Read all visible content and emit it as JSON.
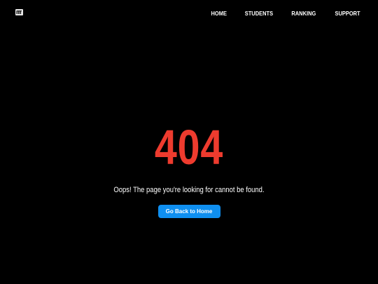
{
  "header": {
    "logo_icon": "logo-icon",
    "nav": {
      "home": "HOME",
      "students": "STUDENTS",
      "ranking": "RANKING",
      "support": "SUPPORT"
    }
  },
  "error": {
    "code": "404",
    "message": "Oops! The page you're looking for cannot be found.",
    "button_label": "Go Back to Home"
  },
  "colors": {
    "background": "#000000",
    "code": "#ee3b2e",
    "button": "#0f8ff0",
    "text": "#ffffff"
  }
}
